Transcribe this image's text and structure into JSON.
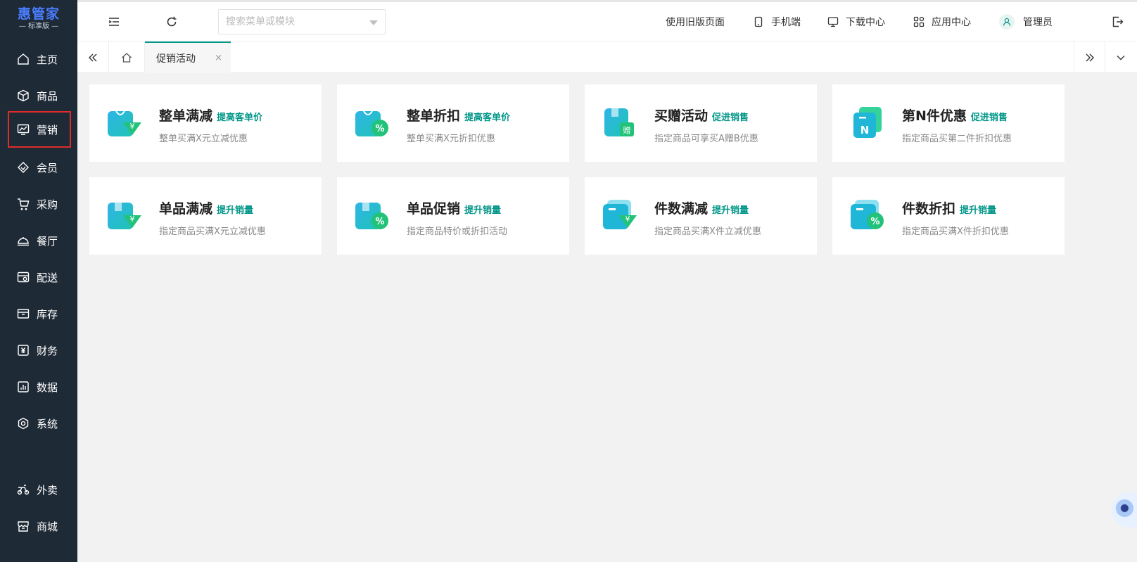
{
  "logo": {
    "title": "惠管家",
    "subtitle": "— 标准版 —"
  },
  "sidebar": {
    "items": [
      {
        "label": "主页",
        "icon": "home-icon"
      },
      {
        "label": "商品",
        "icon": "box-icon"
      },
      {
        "label": "营销",
        "icon": "marketing-icon",
        "active": true
      },
      {
        "label": "会员",
        "icon": "member-icon"
      },
      {
        "label": "采购",
        "icon": "cart-icon"
      },
      {
        "label": "餐厅",
        "icon": "dish-icon"
      },
      {
        "label": "配送",
        "icon": "delivery-icon"
      },
      {
        "label": "库存",
        "icon": "inventory-icon"
      },
      {
        "label": "财务",
        "icon": "finance-icon"
      },
      {
        "label": "数据",
        "icon": "chart-icon"
      },
      {
        "label": "系统",
        "icon": "settings-icon"
      },
      {
        "label": "外卖",
        "icon": "scooter-icon"
      },
      {
        "label": "商城",
        "icon": "shop-icon"
      }
    ]
  },
  "header": {
    "search_placeholder": "搜索菜单或模块",
    "old_page": "使用旧版页面",
    "mobile": "手机端",
    "download": "下载中心",
    "apps": "应用中心",
    "user": "管理员"
  },
  "tabs": {
    "active_label": "促销活动",
    "close": "×"
  },
  "cards": [
    {
      "title": "整单满减",
      "tag": "提高客单价",
      "desc": "整单买满X元立减优惠",
      "icon": "bag-yen-icon"
    },
    {
      "title": "整单折扣",
      "tag": "提高客单价",
      "desc": "整单买满X元折扣优惠",
      "icon": "bag-percent-icon"
    },
    {
      "title": "买赠活动",
      "tag": "促进销售",
      "desc": "指定商品可享买A赠B优惠",
      "icon": "gift-icon"
    },
    {
      "title": "第N件优惠",
      "tag": "促进销售",
      "desc": "指定商品买第二件折扣优惠",
      "icon": "nth-item-icon"
    },
    {
      "title": "单品满减",
      "tag": "提升销量",
      "desc": "指定商品买满X元立减优惠",
      "icon": "item-yen-icon"
    },
    {
      "title": "单品促销",
      "tag": "提升销量",
      "desc": "指定商品特价或折扣活动",
      "icon": "item-percent-icon"
    },
    {
      "title": "件数满减",
      "tag": "提升销量",
      "desc": "指定商品买满X件立减优惠",
      "icon": "count-yen-icon"
    },
    {
      "title": "件数折扣",
      "tag": "提升销量",
      "desc": "指定商品买满X件折扣优惠",
      "icon": "count-percent-icon"
    }
  ],
  "colors": {
    "sidebar_bg": "#1f2a37",
    "accent": "#009688",
    "logo": "#4a7dff",
    "active_outline": "#e02b2b"
  }
}
